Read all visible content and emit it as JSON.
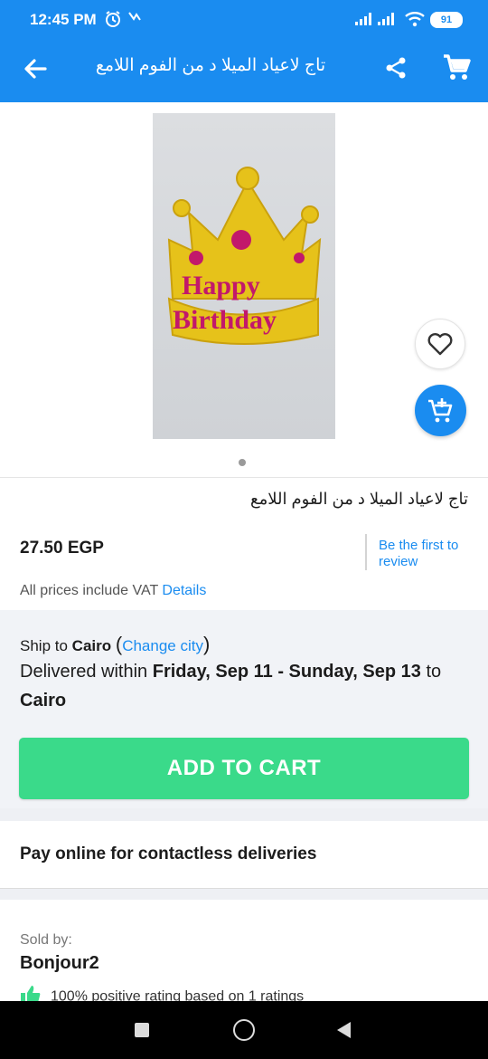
{
  "status_bar": {
    "time": "12:45 PM",
    "battery": "91",
    "icons": [
      "alarm-icon",
      "notification-icon",
      "signal-icon",
      "signal-icon",
      "wifi-icon",
      "battery-icon"
    ]
  },
  "app_bar": {
    "title": "تاج لاعياد الميلا د من الفوم اللامع",
    "icons": [
      "back-arrow-icon",
      "share-icon",
      "cart-icon"
    ]
  },
  "product": {
    "name": "تاج لاعياد الميلا د من الفوم اللامع",
    "price": "27.50 EGP",
    "review_link": "Be the first to review",
    "vat_text": "All prices include VAT",
    "vat_link": "Details",
    "image_lettering": "Happy Birthday",
    "pager_count": 1
  },
  "shipping": {
    "ship_to_label": "Ship to",
    "city": "Cairo",
    "change_city": "Change city",
    "delivered_prefix": "Delivered within",
    "delivery_range": "Friday, Sep 11 - Sunday, Sep 13",
    "delivered_to": "to",
    "delivery_city": "Cairo"
  },
  "actions": {
    "add_to_cart": "ADD TO CART"
  },
  "payment": {
    "contactless_text": "Pay online for contactless deliveries"
  },
  "seller": {
    "sold_by_label": "Sold by:",
    "name": "Bonjour2",
    "rating_text": "100% positive rating based on 1 ratings"
  },
  "colors": {
    "primary": "#1a8cf0",
    "cta_green": "#3ada8a",
    "panel_bg": "#f1f3f7"
  }
}
